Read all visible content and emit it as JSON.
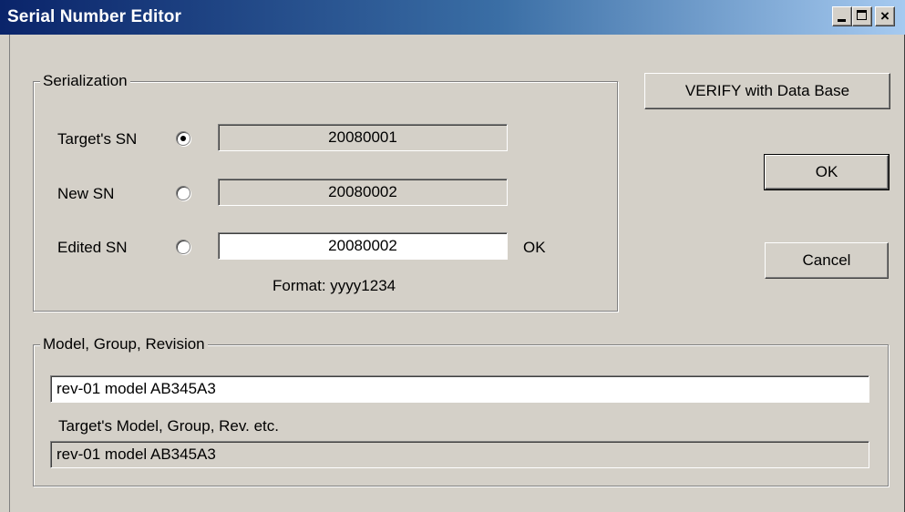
{
  "window": {
    "title": "Serial Number Editor",
    "close_glyph": "×"
  },
  "serialization": {
    "group_title": "Serialization",
    "rows": [
      {
        "label": "Target's SN",
        "value": "20080001",
        "selected": true
      },
      {
        "label": "New SN",
        "value": "20080002",
        "selected": false
      },
      {
        "label": "Edited SN",
        "value": "20080002",
        "selected": false
      }
    ],
    "edited_status": "OK",
    "format_hint": "Format: yyyy1234"
  },
  "buttons": {
    "verify_label": "VERIFY with Data Base",
    "ok_label": "OK",
    "cancel_label": "Cancel"
  },
  "model": {
    "group_title": "Model, Group, Revision",
    "input_value": "rev-01 model AB345A3",
    "target_label": "Target's Model, Group, Rev. etc.",
    "target_value": "rev-01 model AB345A3"
  },
  "colors": {
    "titlebar_start": "#0a246a",
    "titlebar_end": "#a6caf0",
    "face": "#d4d0c8"
  }
}
